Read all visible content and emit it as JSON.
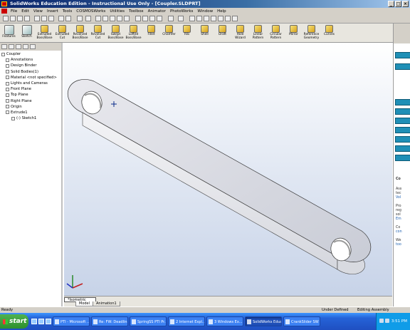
{
  "window": {
    "title": "SolidWorks Education Edition - Instructional Use Only - [Coupler.SLDPRT]",
    "controls": [
      "_",
      "□",
      "×"
    ]
  },
  "menu": [
    "File",
    "Edit",
    "View",
    "Insert",
    "Tools",
    "COSMOSWorks",
    "Utilities",
    "Toolbox",
    "Animator",
    "PhotoWorks",
    "Window",
    "Help"
  ],
  "command_manager": [
    {
      "label": "Features",
      "big": true
    },
    {
      "label": "Sketch",
      "big": true
    },
    {
      "label": "Extruded Boss/Base"
    },
    {
      "label": "Extruded Cut"
    },
    {
      "label": "Revolved Boss/Base"
    },
    {
      "label": "Revolved Cut"
    },
    {
      "label": "Swept Boss/Base"
    },
    {
      "label": "Lofted Boss/Base"
    },
    {
      "label": "Fillet"
    },
    {
      "label": "Chamfer"
    },
    {
      "label": "Rib"
    },
    {
      "label": "Shell"
    },
    {
      "label": "Draft"
    },
    {
      "label": "Hole Wizard"
    },
    {
      "label": "Linear Pattern"
    },
    {
      "label": "Circular Pattern"
    },
    {
      "label": "Mirror"
    },
    {
      "label": "Reference Geometry"
    },
    {
      "label": "Curves"
    }
  ],
  "feature_tree": [
    {
      "label": "Coupler",
      "level": 0
    },
    {
      "label": "Annotations",
      "level": 1
    },
    {
      "label": "Design Binder",
      "level": 1
    },
    {
      "label": "Solid Bodies(1)",
      "level": 1
    },
    {
      "label": "Material <not specified>",
      "level": 1
    },
    {
      "label": "Lights and Cameras",
      "level": 1
    },
    {
      "label": "Front Plane",
      "level": 1
    },
    {
      "label": "Top Plane",
      "level": 1
    },
    {
      "label": "Right Plane",
      "level": 1
    },
    {
      "label": "Origin",
      "level": 1
    },
    {
      "label": "Extrude1",
      "level": 1
    },
    {
      "label": "(-) Sketch1",
      "level": 2
    }
  ],
  "view": {
    "orientation": "*Isometric",
    "tabs": [
      "Model",
      "Animation1"
    ]
  },
  "right_panel": {
    "items": [
      "Co",
      "Ass",
      "tec",
      "Vol",
      "Pro",
      "reg",
      "sol",
      "Em",
      "Co",
      "con",
      "We",
      "too"
    ]
  },
  "status": {
    "left": "Ready",
    "state": "Under Defined",
    "mode": "Editing Assembly"
  },
  "taskbar": {
    "start": "start",
    "tasks": [
      "PTI - Microsoft ...",
      "Re: FW: Deadlin...",
      "SpringSS PTI Pr...",
      "2 Internet Expl...",
      "3 Windows Ex...",
      "SolidWorks Educ...",
      "CrankSlider SW ..."
    ],
    "active_index": 5,
    "clock": "3:51 PM"
  },
  "colors": {
    "title_gradient_start": "#0a246a",
    "chrome": "#d4d0c8",
    "taskbar": "#2563d8",
    "start_green": "#2d8f2d"
  }
}
